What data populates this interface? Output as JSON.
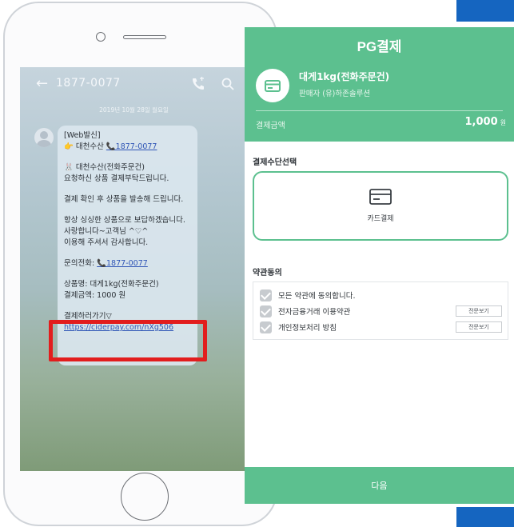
{
  "sms": {
    "number": "1877-0077",
    "date": "2019년 10월 28일 월요일",
    "lines": {
      "tag": "[Web발신]",
      "sender_prefix": "👉 대천수산 ",
      "sender_phone": "📞1877-0077",
      "store": "🐰 대천수산(전화주문건)",
      "request": "요청하신 상품 결제부탁드립니다.",
      "notice": "결제 확인 후 상품을 발송해 드립니다.",
      "promise1": "항상 싱싱한 상품으로 보답하겠습니다.",
      "promise2": "사랑합니다~고객님 ^♡^",
      "promise3": "이용해 주셔서 감사합니다.",
      "contact_prefix": "문의전화: ",
      "contact_phone": "📞1877-0077",
      "product_line": "상품명: 대게1kg(전화주문건)",
      "amount_line": "결제금액: 1000 원",
      "goto": "결제하러가기▽",
      "url": "https://ciderpay.com/nXg506"
    }
  },
  "pay": {
    "title": "PG결제",
    "product_name": "대게1kg(전화주문건)",
    "seller": "판매자 (유)하존솔루션",
    "amount_label": "결제금액",
    "amount_value": "1,000",
    "amount_unit": "원",
    "method_section": "결제수단선택",
    "method_label": "카드결제",
    "terms_section": "약관동의",
    "terms": [
      {
        "label": "모든 약관에 동의합니다."
      },
      {
        "label": "전자금융거래 이용약관",
        "button": "전문보기"
      },
      {
        "label": "개인정보처리 방침",
        "button": "전문보기"
      }
    ],
    "next": "다음"
  },
  "colors": {
    "brand_green": "#5cc08f",
    "highlight_red": "#e21d1d",
    "accent_blue": "#1565c0"
  }
}
